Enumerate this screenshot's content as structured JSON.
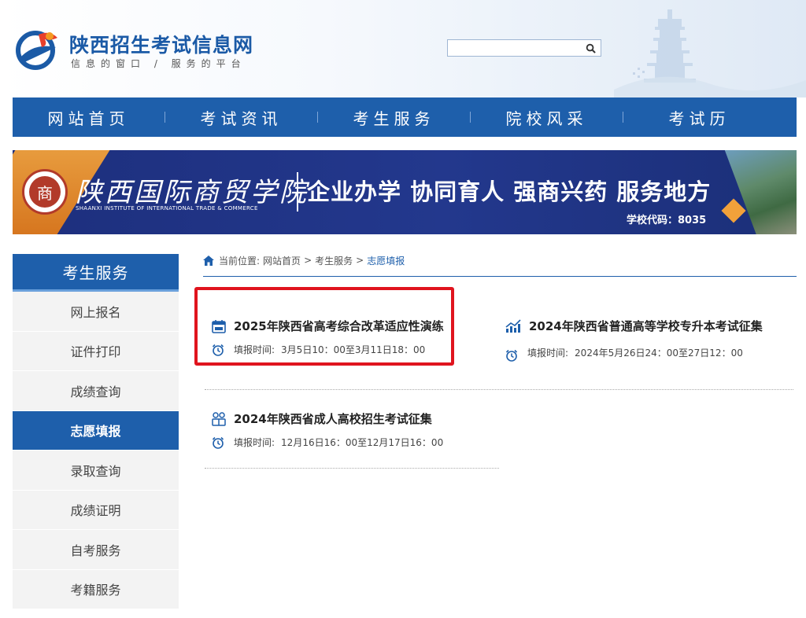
{
  "site": {
    "title": "陕西招生考试信息网",
    "slogan": "信息的窗口 / 服务的平台"
  },
  "search": {
    "placeholder": ""
  },
  "nav": [
    {
      "label": "网站首页"
    },
    {
      "label": "考试资讯"
    },
    {
      "label": "考生服务"
    },
    {
      "label": "院校风采"
    },
    {
      "label": "考试历"
    }
  ],
  "banner": {
    "emblem_char": "商",
    "college_name": "陕西国际商贸学院",
    "college_en": "SHAANXI INSTITUTE OF INTERNATIONAL TRADE & COMMERCE",
    "slogan": "企业办学 协同育人 强商兴药 服务地方",
    "code": "学校代码：8035"
  },
  "sidebar": {
    "title": "考生服务",
    "items": [
      {
        "label": "网上报名",
        "active": false
      },
      {
        "label": "证件打印",
        "active": false
      },
      {
        "label": "成绩查询",
        "active": false
      },
      {
        "label": "志愿填报",
        "active": true
      },
      {
        "label": "录取查询",
        "active": false
      },
      {
        "label": "成绩证明",
        "active": false
      },
      {
        "label": "自考服务",
        "active": false
      },
      {
        "label": "考籍服务",
        "active": false
      }
    ]
  },
  "breadcrumb": {
    "prefix": "当前位置:",
    "items": [
      "网站首页",
      "考生服务",
      "志愿填报"
    ],
    "separator": ">"
  },
  "entries": [
    {
      "title": "2025年陕西省高考综合改革适应性演练",
      "time_label": "填报时间:",
      "time_value": "3月5日10：00至3月11日18：00",
      "icon": "exam-calendar-icon"
    },
    {
      "title": "2024年陕西省普通高等学校专升本考试征集",
      "time_label": "填报时间:",
      "time_value": "2024年5月26日24：00至27日12：00",
      "icon": "trend-chart-icon"
    },
    {
      "title": "2024年陕西省成人高校招生考试征集",
      "time_label": "填报时间:",
      "time_value": "12月16日16：00至12月17日16：00",
      "icon": "people-icon"
    }
  ],
  "colors": {
    "primary": "#1e5fab",
    "highlight": "#e0141e",
    "banner_bg": "#1d2f7d",
    "accent_orange": "#f2a13a"
  }
}
